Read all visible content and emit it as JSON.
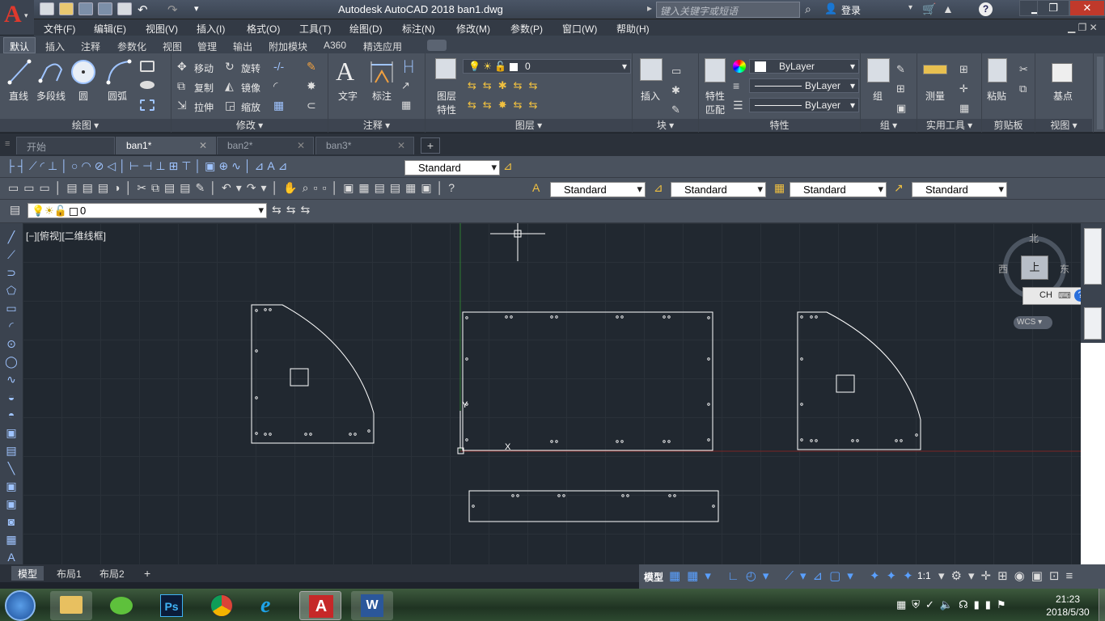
{
  "window": {
    "title": "Autodesk AutoCAD 2018    ban1.dwg",
    "search_placeholder": "键入关键字或短语",
    "login": "登录"
  },
  "menu": [
    "文件(F)",
    "编辑(E)",
    "视图(V)",
    "插入(I)",
    "格式(O)",
    "工具(T)",
    "绘图(D)",
    "标注(N)",
    "修改(M)",
    "参数(P)",
    "窗口(W)",
    "帮助(H)"
  ],
  "ribbon_tabs": [
    "默认",
    "插入",
    "注释",
    "参数化",
    "视图",
    "管理",
    "输出",
    "附加模块",
    "A360",
    "精选应用"
  ],
  "ribbon": {
    "draw": {
      "line": "直线",
      "polyline": "多段线",
      "circle": "圆",
      "arc": "圆弧",
      "panel": "绘图 ▾"
    },
    "modify": {
      "move": "移动",
      "rotate": "旋转",
      "copy": "复制",
      "mirror": "镜像",
      "stretch": "拉伸",
      "scale": "缩放",
      "panel": "修改 ▾"
    },
    "annotation": {
      "text": "文字",
      "dimension": "标注",
      "panel": "注释 ▾"
    },
    "layers": {
      "layer_props": "图层\n特性",
      "current_layer": "0",
      "panel": "图层 ▾",
      "props_l1": "图层",
      "props_l2": "特性"
    },
    "block": {
      "insert": "插入",
      "panel": "块 ▾"
    },
    "properties": {
      "match_l1": "特性",
      "match_l2": "匹配",
      "color": "ByLayer",
      "linetype": "ByLayer",
      "lineweight": "ByLayer",
      "panel": "特性"
    },
    "groups": {
      "group": "组",
      "panel": "组 ▾"
    },
    "utilities": {
      "measure": "测量",
      "panel": "实用工具 ▾"
    },
    "clipboard": {
      "paste": "粘贴",
      "panel": "剪贴板"
    },
    "view": {
      "base": "基点",
      "panel": "视图 ▾"
    }
  },
  "doc_tabs": [
    {
      "label": "开始"
    },
    {
      "label": "ban1*"
    },
    {
      "label": "ban2*"
    },
    {
      "label": "ban3*"
    }
  ],
  "toolbars": {
    "dimstyle": "Standard",
    "textstyle": "Standard",
    "dimstyle2": "Standard",
    "tablestyle": "Standard",
    "mleaderstyle": "Standard",
    "layer": "0"
  },
  "viewport": {
    "label": "[−][俯视][二维线框]",
    "viewcube": {
      "north": "北",
      "west": "西",
      "east": "东",
      "top": "上"
    },
    "wcs": "WCS",
    "ime": "CH"
  },
  "layout_tabs": [
    "模型",
    "布局1",
    "布局2"
  ],
  "status": {
    "model": "模型",
    "scale": "1:1"
  },
  "clock": {
    "time": "21:23",
    "date": "2018/5/30"
  },
  "colors": {
    "accent": "#e0392d",
    "canvas": "#212830",
    "ribbon": "#4b535f"
  }
}
